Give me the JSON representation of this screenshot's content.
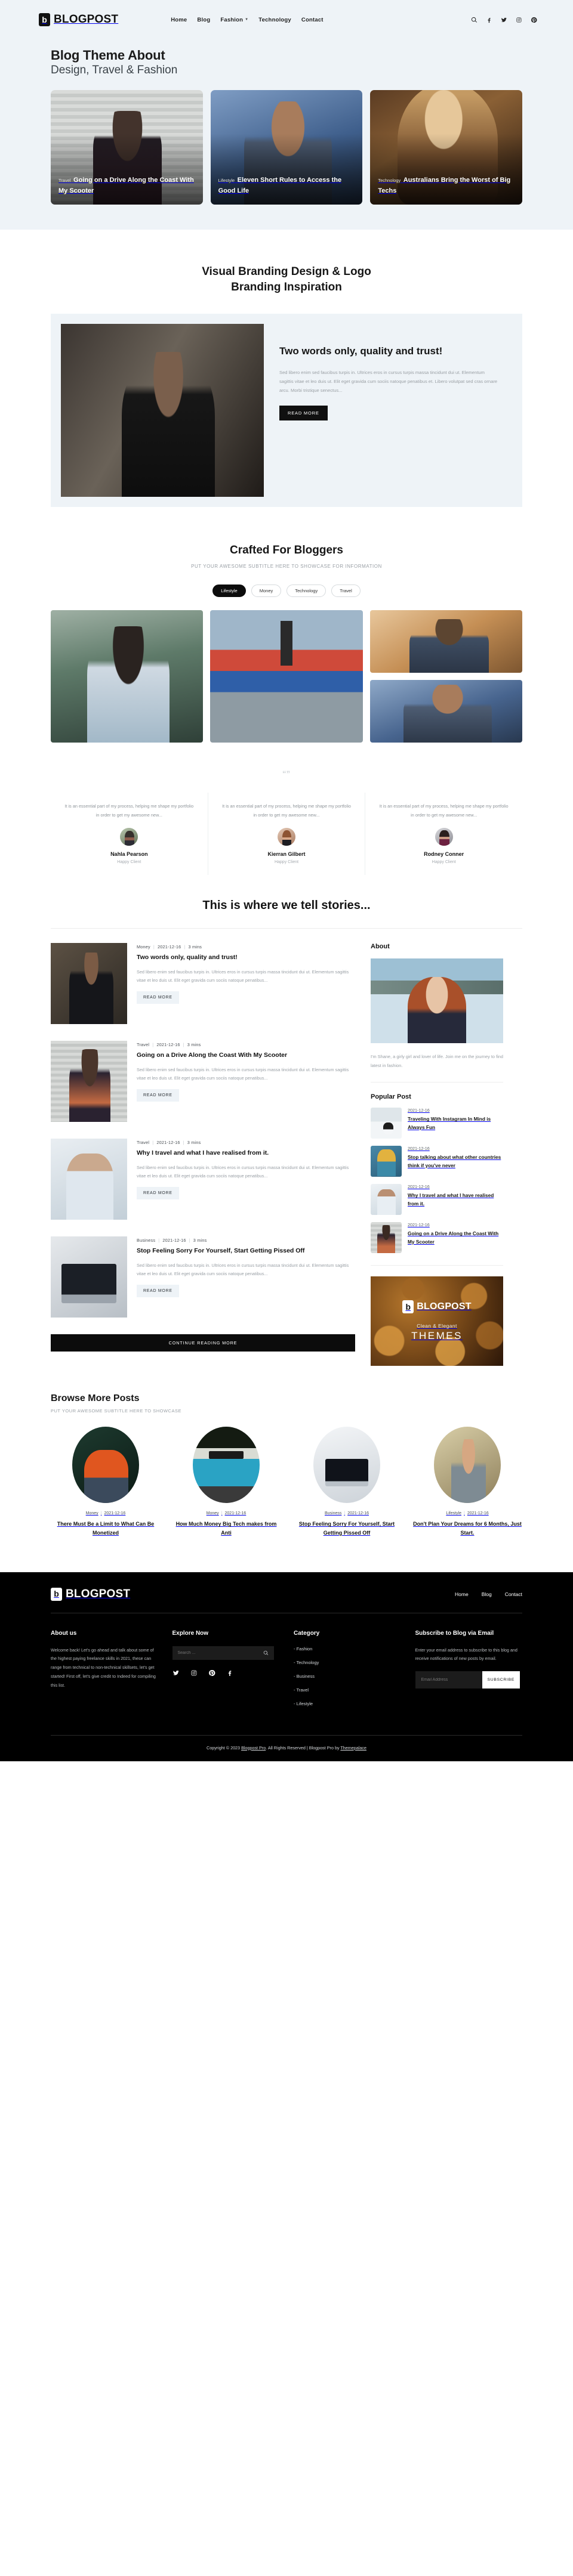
{
  "brand": {
    "name": "BLOGPOST",
    "mark": "b"
  },
  "header": {
    "nav": [
      {
        "label": "Home",
        "caret": false
      },
      {
        "label": "Blog",
        "caret": false
      },
      {
        "label": "Fashion",
        "caret": true
      },
      {
        "label": "Technology",
        "caret": false
      },
      {
        "label": "Contact",
        "caret": false
      }
    ],
    "social": [
      "search-icon",
      "facebook-icon",
      "twitter-icon",
      "instagram-icon",
      "pinterest-icon"
    ]
  },
  "hero": {
    "title": "Blog Theme About",
    "subtitle": "Design, Travel & Fashion",
    "cards": [
      {
        "category": "Travel",
        "title": "Going on a Drive Along the Coast With My Scooter"
      },
      {
        "category": "Lifestyle",
        "title": "Eleven Short Rules to Access the Good Life"
      },
      {
        "category": "Technology",
        "title": "Australians Bring the Worst of Big Techs"
      }
    ]
  },
  "branding": {
    "title_line1": "Visual Branding Design & Logo",
    "title_line2": "Branding Inspiration",
    "feature": {
      "heading": "Two words only, quality and trust!",
      "body": "Sed libero enim sed faucibus turpis in. Ultrices eros in cursus turpis massa tincidunt dui ut. Elementum sagittis vitae et leo duis ut. Elit eget gravida cum sociis natoque penatibus et. Libero volutpat sed cras ornare arcu. Morbi tristique senectus...",
      "cta": "READ MORE"
    }
  },
  "crafted": {
    "title": "Crafted For Bloggers",
    "subtitle": "PUT YOUR AWESOME SUBTITLE HERE TO SHOWCASE FOR INFORMATION",
    "filters": [
      {
        "label": "Lifestyle",
        "active": true
      },
      {
        "label": "Money",
        "active": false
      },
      {
        "label": "Technology",
        "active": false
      },
      {
        "label": "Travel",
        "active": false
      }
    ]
  },
  "testimonials": {
    "quote_glyph": "“”",
    "items": [
      {
        "quote": "It is an essential part of my process, helping me shape my portfolio in order to get my awesome new...",
        "name": "Nahla Pearson",
        "role": "Happy Client"
      },
      {
        "quote": "It is an essential part of my process, helping me shape my portfolio in order to get my awesome new...",
        "name": "Kierran Gilbert",
        "role": "Happy Client"
      },
      {
        "quote": "It is an essential part of my process, helping me shape my portfolio in order to get my awesome new...",
        "name": "Rodney Conner",
        "role": "Happy Client"
      }
    ]
  },
  "stories": {
    "title": "This is where we tell stories...",
    "excerpt": "Sed libero enim sed faucibus turpis in. Ultrices eros in cursus turpis massa tincidunt dui ut. Elementum sagittis vitae et leo duis ut. Elit eget gravida cum sociis natoque penatibus...",
    "read_more": "READ MORE",
    "continue_label": "CONTINUE READING MORE",
    "posts": [
      {
        "category": "Money",
        "date": "2021-12-16",
        "read_time": "3 mins",
        "title": "Two words only, quality and trust!"
      },
      {
        "category": "Travel",
        "date": "2021-12-16",
        "read_time": "3 mins",
        "title": "Going on a Drive Along the Coast With My Scooter"
      },
      {
        "category": "Travel",
        "date": "2021-12-16",
        "read_time": "3 mins",
        "title": "Why I travel and what I have realised from it."
      },
      {
        "category": "Business",
        "date": "2021-12-16",
        "read_time": "3 mins",
        "title": "Stop Feeling Sorry For Yourself, Start Getting Pissed Off"
      }
    ]
  },
  "sidebar": {
    "about_heading": "About",
    "about_text": "I'm Shane, a girly girl and lover of life. Join me on the journey to find latest in fashion.",
    "popular_heading": "Popular Post",
    "popular": [
      {
        "date": "2021-12-16",
        "title": "Traveling With Instagram In Mind is Always Fun"
      },
      {
        "date": "2021-12-16",
        "title": "Stop talking about what other countries think if you've never"
      },
      {
        "date": "2021-12-16",
        "title": "Why I travel and what I have realised from it."
      },
      {
        "date": "2021-12-16",
        "title": "Going on a Drive Along the Coast With My Scooter"
      }
    ],
    "promo": {
      "brand": "BLOGPOST",
      "sub": "Clean & Elegant",
      "big": "THEMES"
    }
  },
  "browse": {
    "title": "Browse More Posts",
    "subtitle": "PUT YOUR AWESOME SUBTITLE HERE TO SHOWCASE",
    "cards": [
      {
        "category": "Money",
        "date": "2021-12-16",
        "title": "There Must Be a Limit to What Can Be Monetized"
      },
      {
        "category": "Money",
        "date": "2021-12-16",
        "title": "How Much Money Big Tech makes from Anti"
      },
      {
        "category": "Business",
        "date": "2021-12-16",
        "title": "Stop Feeling Sorry For Yourself, Start Getting Pissed Off"
      },
      {
        "category": "Lifestyle",
        "date": "2021-12-16",
        "title": "Don't Plan Your Dreams for 6 Months, Just Start."
      }
    ]
  },
  "footer": {
    "nav": [
      {
        "label": "Home"
      },
      {
        "label": "Blog"
      },
      {
        "label": "Contact"
      }
    ],
    "about_heading": "About us",
    "about_text": "Welcome back! Let's go ahead and talk about some of the highest paying freelance skills in 2021, these can range from technical to non-technical skillsets, let's get started! First off, let's give credit to Indeed for compiling this list.",
    "explore_heading": "Explore Now",
    "search_placeholder": "Search ...",
    "social": [
      "twitter-icon",
      "instagram-icon",
      "pinterest-icon",
      "facebook-icon"
    ],
    "category_heading": "Category",
    "categories": [
      "- Fashion",
      "- Technology",
      "- Business",
      "- Travel",
      "- Lifestyle"
    ],
    "subscribe_heading": "Subscribe to Blog via Email",
    "subscribe_text": "Enter your email address to subscribe to this blog and receive notifications of new posts by email.",
    "email_placeholder": "Email Address",
    "subscribe_button": "SUBSCRIBE",
    "copyright_pre": "Copyright © 2023 ",
    "copyright_link1": "Blogpost Pro",
    "copyright_mid": ". All Rights Reserved | Blogpost Pro by ",
    "copyright_link2": "Themepalace"
  }
}
